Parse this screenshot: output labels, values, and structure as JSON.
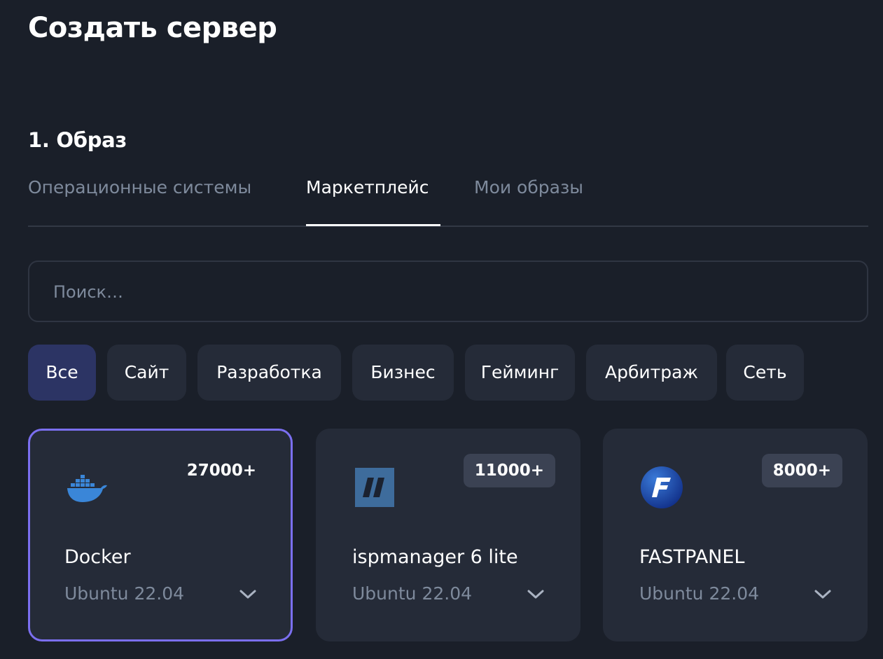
{
  "page": {
    "title": "Создать сервер"
  },
  "section": {
    "title": "1. Образ"
  },
  "tabs": [
    {
      "label": "Операционные системы",
      "active": false
    },
    {
      "label": "Маркетплейс",
      "active": true
    },
    {
      "label": "Мои образы",
      "active": false
    }
  ],
  "search": {
    "placeholder": "Поиск…",
    "value": ""
  },
  "filters": [
    {
      "label": "Все",
      "active": true
    },
    {
      "label": "Сайт",
      "active": false
    },
    {
      "label": "Разработка",
      "active": false
    },
    {
      "label": "Бизнес",
      "active": false
    },
    {
      "label": "Гейминг",
      "active": false
    },
    {
      "label": "Арбитраж",
      "active": false
    },
    {
      "label": "Сеть",
      "active": false
    }
  ],
  "cards": [
    {
      "name": "Docker",
      "badge": "27000+",
      "os": "Ubuntu 22.04",
      "icon": "docker-icon",
      "selected": true
    },
    {
      "name": "ispmanager 6 lite",
      "badge": "11000+",
      "os": "Ubuntu 22.04",
      "icon": "ispmanager-icon",
      "selected": false
    },
    {
      "name": "FASTPANEL",
      "badge": "8000+",
      "os": "Ubuntu 22.04",
      "icon": "fastpanel-icon",
      "selected": false
    }
  ],
  "colors": {
    "background": "#1a1f29",
    "card": "#252b38",
    "accent_border": "#7b6ff0",
    "active_filter": "#2c3464",
    "muted_text": "#7e8a9c"
  }
}
